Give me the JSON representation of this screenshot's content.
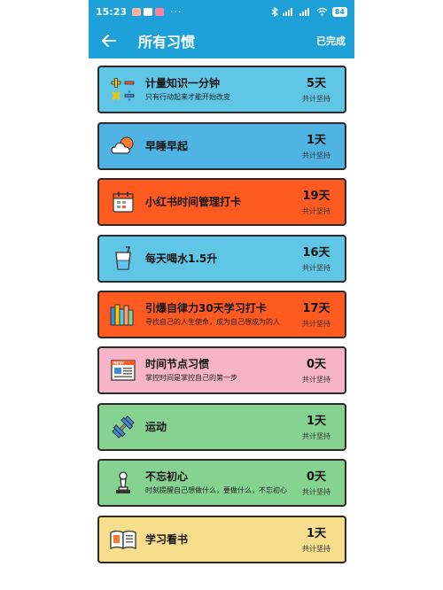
{
  "status_bar": {
    "time": "15:23",
    "dots": "···",
    "battery": "84"
  },
  "header": {
    "title": "所有习惯",
    "done_label": "已完成"
  },
  "habits": [
    {
      "name": "计量知识一分钟",
      "subtitle": "只有行动起来才能开始改变",
      "days": "5天",
      "streak_label": "共计坚持",
      "color": "#5fc6e6",
      "icon": "math-symbols-icon"
    },
    {
      "name": "早睡早起",
      "subtitle": "",
      "days": "1天",
      "streak_label": "共计坚持",
      "color": "#4fb3e3",
      "icon": "sun-cloud-icon"
    },
    {
      "name": "小红书时间管理打卡",
      "subtitle": "",
      "days": "19天",
      "streak_label": "共计坚持",
      "color": "#ff5a1f",
      "icon": "calendar-icon"
    },
    {
      "name": "每天喝水1.5升",
      "subtitle": "",
      "days": "16天",
      "streak_label": "共计坚持",
      "color": "#5fc6e6",
      "icon": "water-glass-icon"
    },
    {
      "name": "引爆自律力30天学习打卡",
      "subtitle": "寻找自己的人生使命，成为自己想成为的人",
      "days": "17天",
      "streak_label": "共计坚持",
      "color": "#ff5a1f",
      "icon": "books-icon"
    },
    {
      "name": "时间节点习惯",
      "subtitle": "掌控时间是掌控自己的第一步",
      "days": "0天",
      "streak_label": "共计坚持",
      "color": "#f7b3c7",
      "icon": "newspaper-icon"
    },
    {
      "name": "运动",
      "subtitle": "",
      "days": "1天",
      "streak_label": "共计坚持",
      "color": "#86d291",
      "icon": "dumbbell-icon"
    },
    {
      "name": "不忘初心",
      "subtitle": "时刻提醒自己想做什么，要做什么，不忘初心",
      "days": "0天",
      "streak_label": "共计坚持",
      "color": "#86d291",
      "icon": "chess-pawn-icon"
    },
    {
      "name": "学习看书",
      "subtitle": "",
      "days": "1天",
      "streak_label": "共计坚持",
      "color": "#f7de8c",
      "icon": "open-book-icon"
    }
  ]
}
